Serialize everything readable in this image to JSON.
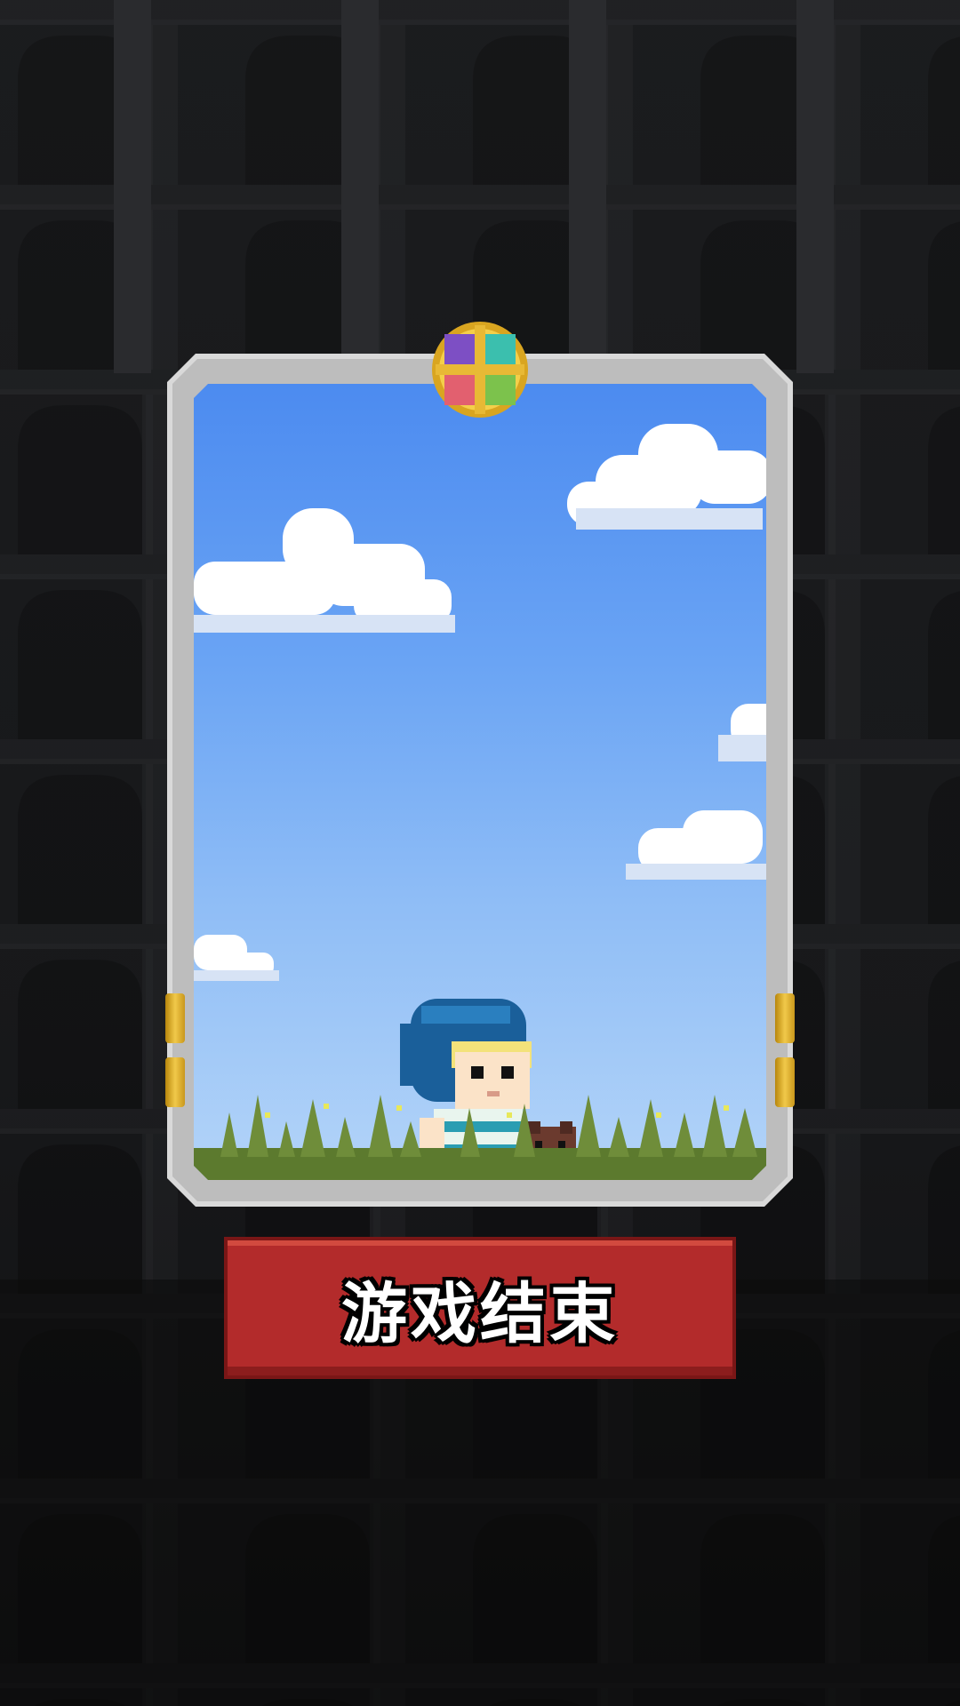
{
  "screen": {
    "name": "game-over-screen",
    "background_color": "#0f1011"
  },
  "card": {
    "emblem_icon": "four-gem-emblem-icon",
    "character_icon": "hooded-hero-icon",
    "pet_icon": "brown-dog-icon",
    "frame_color": "#d9d9d9",
    "sky_color": "#4c8bf0"
  },
  "game_over_button": {
    "label": "游戏结束",
    "color": "#b32b2b"
  }
}
